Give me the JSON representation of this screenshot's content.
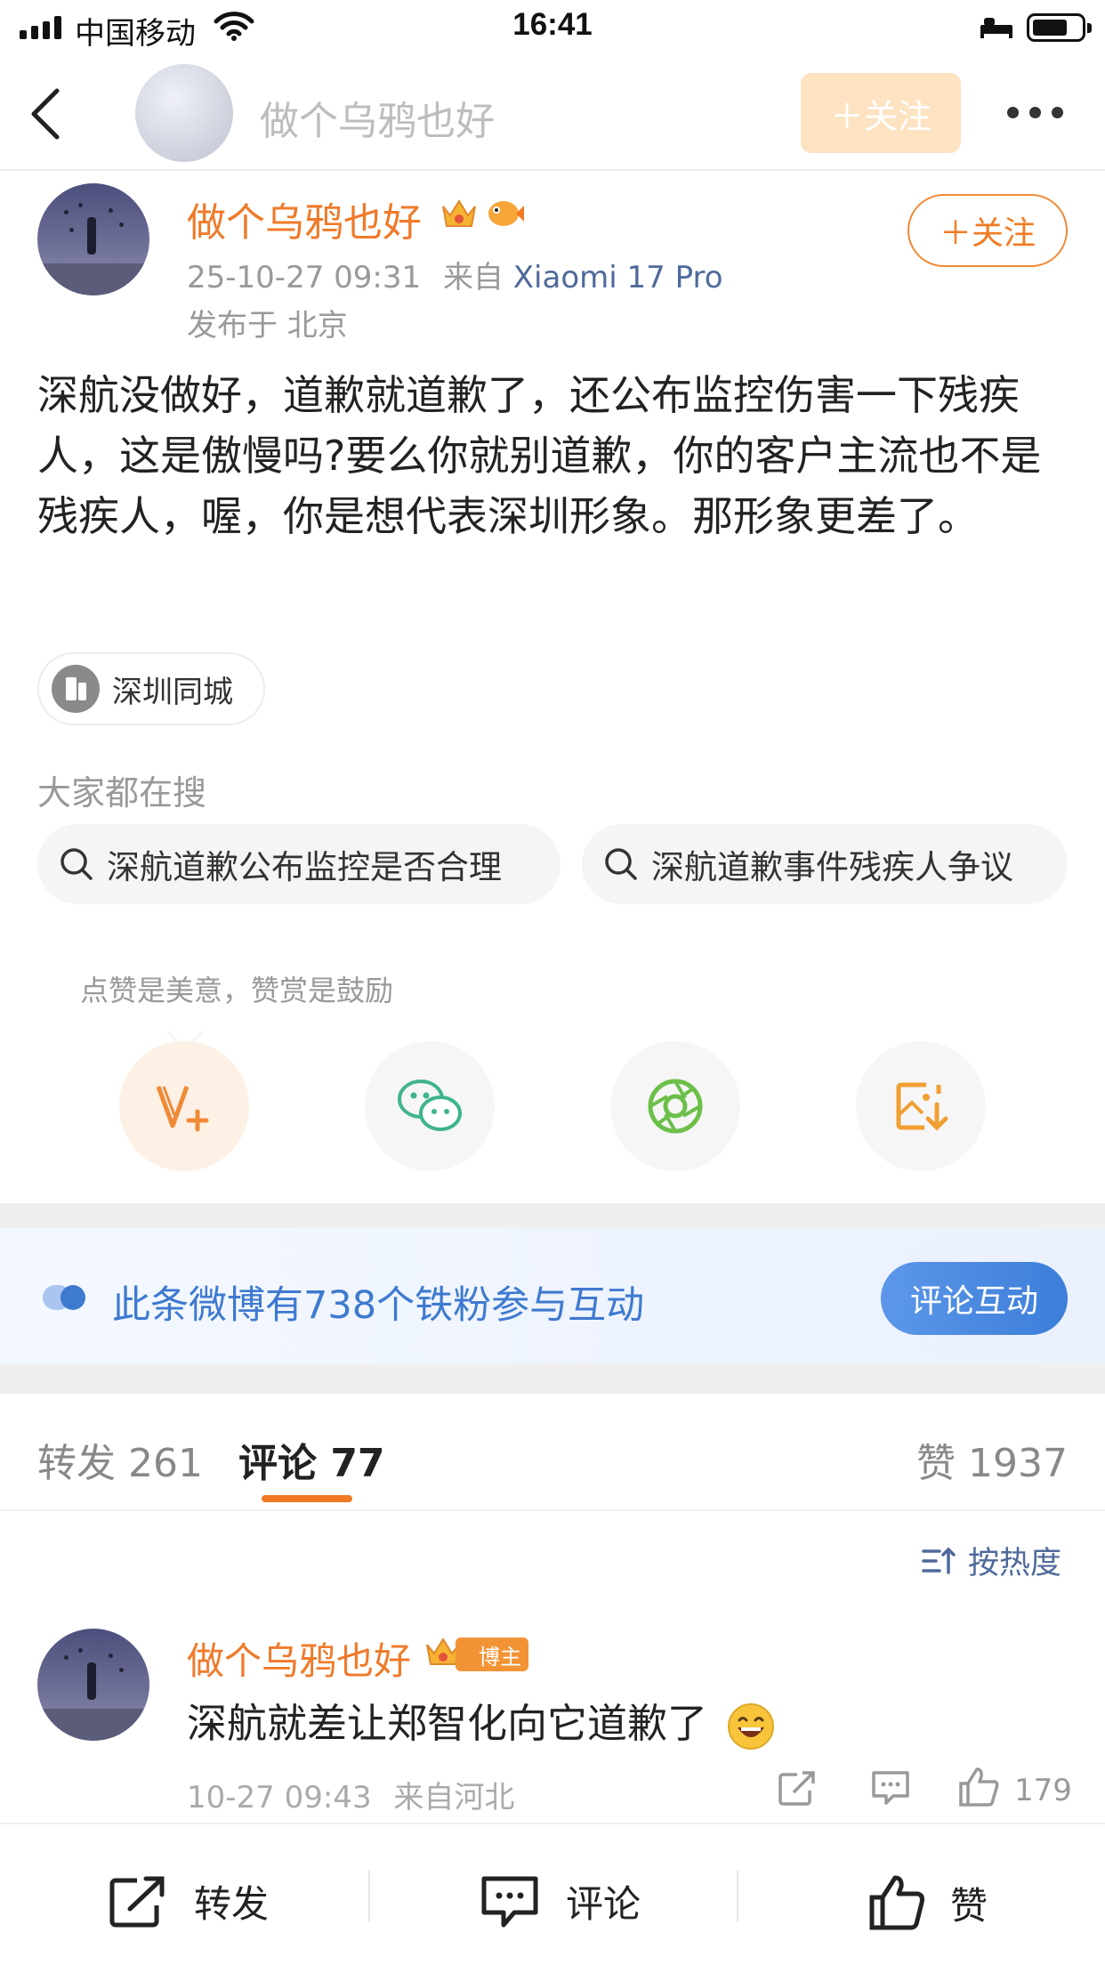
{
  "status_bar": {
    "carrier": "中国移动",
    "time": "16:41"
  },
  "nav": {
    "title": "做个乌鸦也好",
    "follow_label": "＋关注"
  },
  "post": {
    "author": "做个乌鸦也好",
    "time": "25-10-27 09:31",
    "source_prefix": "来自",
    "device": "Xiaomi 17 Pro",
    "location": "发布于 北京",
    "follow_label": "＋关注",
    "body": "深航没做好，道歉就道歉了，还公布监控伤害一下残疾人，这是傲慢吗?要么你就别道歉，你的客户主流也不是残疾人，喔，你是想代表深圳形象。那形象更差了。",
    "topic": "深圳同城"
  },
  "search": {
    "heading": "大家都在搜",
    "items": [
      "深航道歉公布监控是否合理",
      "深航道歉事件残疾人争议"
    ]
  },
  "reward": {
    "hint": "点赞是美意，赞赏是鼓励"
  },
  "share_icons": [
    "reward-v-icon",
    "wechat-icon",
    "moments-icon",
    "save-image-icon"
  ],
  "fan_banner": {
    "text": "此条微博有738个铁粉参与互动",
    "button": "评论互动"
  },
  "tabs": {
    "repost": "转发 261",
    "comment": "评论 77",
    "like": "赞 1937"
  },
  "sort": {
    "label": "按热度"
  },
  "comment": {
    "author": "做个乌鸦也好",
    "badge": "博主",
    "text": "深航就差让郑智化向它道歉了",
    "time": "10-27 09:43",
    "source": "来自河北",
    "likes": "179"
  },
  "bottom_bar": {
    "repost": "转发",
    "comment": "评论",
    "like": "赞"
  },
  "colors": {
    "accent": "#f07b23",
    "link_blue": "#3e7ad0",
    "name_orange": "#ef7a2a"
  }
}
